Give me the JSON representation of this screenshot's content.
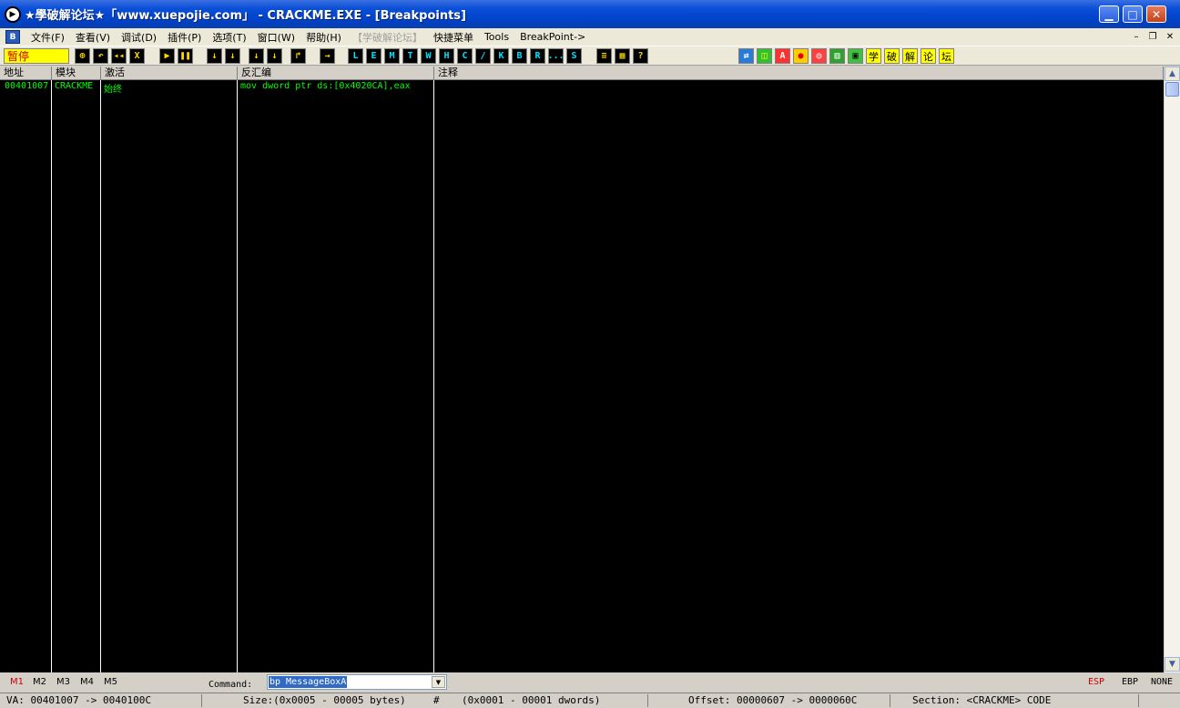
{
  "window": {
    "title": "★學破解论坛★「www.xuepojie.com」  - CRACKME.EXE - [Breakpoints]",
    "icon": "debugger-app-icon",
    "controls": [
      "minimize",
      "maximize",
      "close"
    ]
  },
  "menu": {
    "app_icon_label": "B",
    "items": [
      "文件(F)",
      "查看(V)",
      "调试(D)",
      "插件(P)",
      "选项(T)",
      "窗口(W)",
      "帮助(H)",
      "【学破解论坛】",
      "快捷菜单",
      "Tools",
      "BreakPoint->"
    ]
  },
  "toolbar": {
    "status": "暂停",
    "run_buttons": [
      "⊕",
      "↶",
      "◂◂",
      "X",
      "▶",
      "❚❚",
      "↓",
      "↓",
      "↓",
      "↓",
      "↱",
      "→"
    ],
    "window_buttons": [
      "L",
      "E",
      "M",
      "T",
      "W",
      "H",
      "C",
      "/",
      "K",
      "B",
      "R",
      "...",
      "S"
    ],
    "view_buttons": [
      "≡",
      "▦",
      "?"
    ],
    "right_buttons": [
      "⇄",
      "◫",
      "A",
      "●",
      "◎",
      "▥",
      "▣"
    ],
    "forum_buttons": [
      "学",
      "破",
      "解",
      "论",
      "坛"
    ]
  },
  "breakpoints": {
    "columns": [
      "地址",
      "模块",
      "激活",
      "反汇编",
      "注释"
    ],
    "rows": [
      {
        "address": "00401007",
        "module": "CRACKME",
        "active": "始终",
        "disasm": "mov dword ptr ds:[0x4020CA],eax",
        "comment": ""
      }
    ]
  },
  "command_bar": {
    "tabs": [
      "M1",
      "M2",
      "M3",
      "M4",
      "M5"
    ],
    "label": "Command:",
    "value": "bp MessageBoxA",
    "registers": [
      "ESP",
      "EBP",
      "NONE"
    ]
  },
  "status_bar": {
    "va": "VA: 00401007 -> 0040100C",
    "size": "Size:(0x0005 - 00005 bytes)",
    "hash": "#",
    "dwords": "(0x0001 - 00001 dwords)",
    "offset": "Offset: 00000607 -> 0000060C",
    "section": "Section: <CRACKME> CODE"
  },
  "colors": {
    "title_bar": "#0042c8",
    "list_background": "#000000",
    "list_text": "#00ff00",
    "status_pause_bg": "#ffff00",
    "active_tab": "#d00000"
  }
}
